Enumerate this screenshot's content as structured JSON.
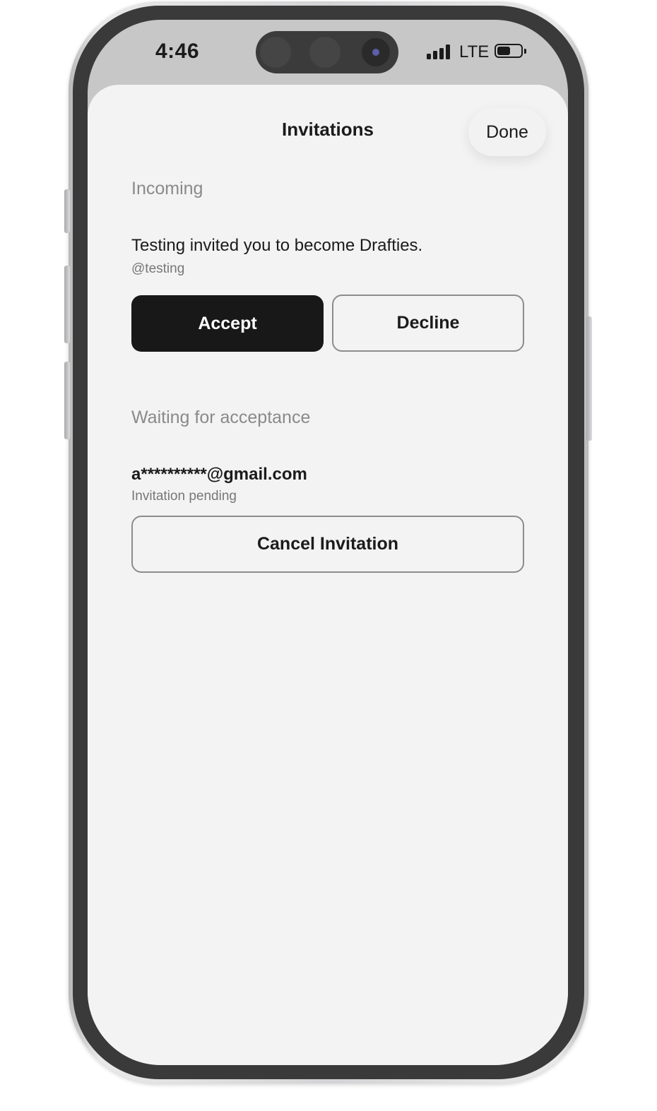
{
  "status_bar": {
    "time": "4:46",
    "network": "LTE",
    "signal_bars": 4,
    "battery_level": 0.55
  },
  "sheet": {
    "title": "Invitations",
    "done_label": "Done"
  },
  "incoming": {
    "section_label": "Incoming",
    "message": "Testing invited you to become Drafties.",
    "handle": "@testing",
    "accept_label": "Accept",
    "decline_label": "Decline"
  },
  "waiting": {
    "section_label": "Waiting for acceptance",
    "email": "a**********@gmail.com",
    "status": "Invitation pending",
    "cancel_label": "Cancel Invitation"
  },
  "colors": {
    "sheet_background": "#f3f3f3",
    "primary_button": "#181818",
    "secondary_text": "#8a8a8a",
    "outline": "#8c8c8c"
  }
}
